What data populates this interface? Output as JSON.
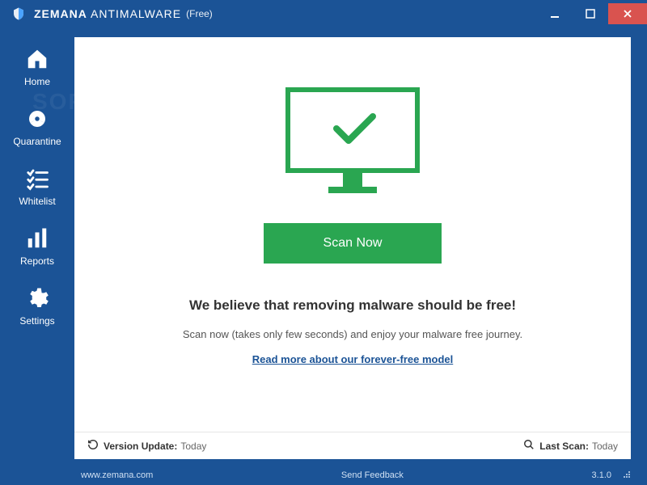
{
  "window": {
    "title_brand": "ZEMANA",
    "title_product": "ANTIMALWARE",
    "edition": "(Free)"
  },
  "sidebar": {
    "items": [
      {
        "label": "Home"
      },
      {
        "label": "Quarantine"
      },
      {
        "label": "Whitelist"
      },
      {
        "label": "Reports"
      },
      {
        "label": "Settings"
      }
    ]
  },
  "main": {
    "scan_button": "Scan Now",
    "headline": "We believe that removing malware should be free!",
    "subtext": "Scan now (takes only few seconds) and enjoy your malware free journey.",
    "readmore": "Read more about our forever-free model"
  },
  "status": {
    "version_update_label": "Version Update:",
    "version_update_value": "Today",
    "last_scan_label": "Last Scan:",
    "last_scan_value": "Today"
  },
  "footer": {
    "website": "www.zemana.com",
    "feedback": "Send Feedback",
    "version": "3.1.0"
  },
  "colors": {
    "primary": "#1b5396",
    "accent": "#2aa651",
    "close": "#d9534f"
  }
}
